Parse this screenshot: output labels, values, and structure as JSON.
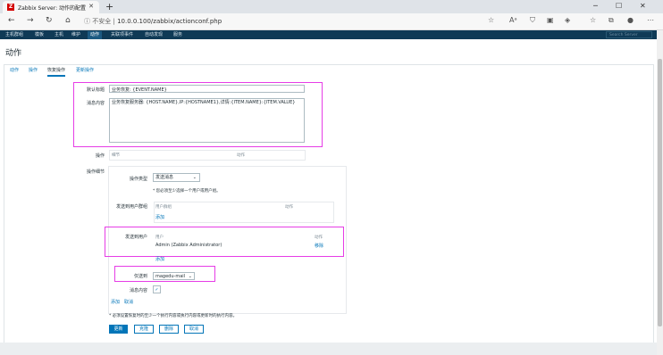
{
  "browser": {
    "tab_title": "Zabbix Server: 动作的配置",
    "tab_close": "✕",
    "new_tab": "+",
    "security_label": "不安全",
    "url": "10.0.0.100/zabbix/actionconf.php"
  },
  "nav": {
    "items": [
      "主机群组",
      "模板",
      "主机",
      "维护",
      "动作",
      "关联项事件",
      "自动发现",
      "服务"
    ],
    "search_placeholder": "Search Server"
  },
  "page": {
    "title": "动作"
  },
  "tabs": [
    "动作",
    "操作",
    "恢复操作",
    "更新操作"
  ],
  "form": {
    "default_subject_label": "默认标题",
    "default_subject_value": "业务恢复: {EVENT.NAME}",
    "message_label": "消息内容",
    "message_value": "业务恢复服务器: {HOST.NAME},IP:{HOSTNAME1},详情:{ITEM.NAME}:{ITEM.VALUE}",
    "operations_label": "操作",
    "operations_header_detail": "细节",
    "operations_header_action": "动作",
    "op_details_label": "操作细节",
    "op_type_label": "操作类型",
    "op_type_value": "发送消息",
    "op_type_note": "* 您必须至少选择一个用户或用户组。",
    "send_to_groups_label": "发送到用户群组",
    "groups_header_group": "用户群组",
    "groups_header_action": "动作",
    "add_link": "添加",
    "send_to_users_label": "发送到用户",
    "users_header_user": "用户",
    "users_header_action": "动作",
    "user_row": "Admin (Zabbix Administrator)",
    "remove_link": "移除",
    "add_users_link": "添加",
    "send_only_label": "仅送到",
    "send_only_value": "magedu-mail",
    "default_message_label": "消息内容",
    "op_add_link": "添加",
    "op_cancel_link": "取消",
    "footer_note": "* 必须设置恢复时的至少一个执行内容或执行内容或更新时的执行内容。"
  },
  "buttons": {
    "update": "更新",
    "clone": "克隆",
    "delete": "删除",
    "cancel": "取消"
  },
  "colors": {
    "nav_bg": "#0f3a56",
    "accent": "#0275b8",
    "highlight": "#e63de6",
    "favicon": "#d40000"
  }
}
